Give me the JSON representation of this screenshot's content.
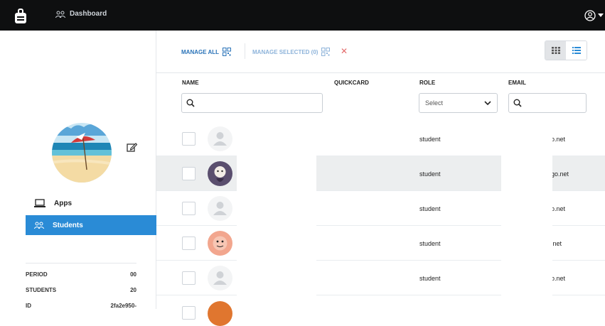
{
  "topbar": {
    "dashboard_label": "Dashboard"
  },
  "sidebar": {
    "nav": [
      {
        "label": "Apps"
      },
      {
        "label": "Students"
      }
    ],
    "info": [
      {
        "key": "PERIOD",
        "value": "00"
      },
      {
        "key": "STUDENTS",
        "value": "20"
      },
      {
        "key": "ID",
        "value": "2fa2e950-"
      }
    ]
  },
  "toolbar": {
    "manage_all": "MANAGE ALL",
    "manage_selected": "MANAGE SELECTED (0)"
  },
  "table": {
    "headers": {
      "name": "NAME",
      "quickcard": "QUICKCARD",
      "role": "ROLE",
      "email": "EMAIL"
    },
    "role_select": "Select",
    "rows": [
      {
        "role": "student",
        "email": "o.net"
      },
      {
        "role": "student",
        "email": "go.net"
      },
      {
        "role": "student",
        "email": "o.net"
      },
      {
        "role": "student",
        "email": ".net"
      },
      {
        "role": "student",
        "email": "o.net"
      }
    ]
  },
  "colors": {
    "accent": "#2a8bd6",
    "topbar": "#0e0f10",
    "danger": "#e36b6b"
  }
}
